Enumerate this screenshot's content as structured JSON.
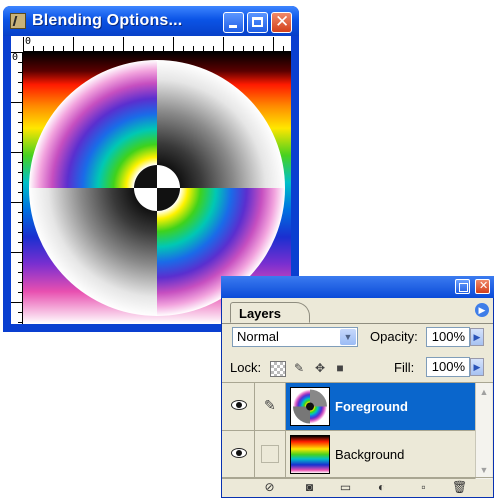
{
  "document_window": {
    "title": "Blending Options...",
    "ruler_h_label": "0",
    "ruler_v_label": "0"
  },
  "layers_panel": {
    "tab_label": "Layers",
    "blend_mode": "Normal",
    "opacity_label": "Opacity:",
    "opacity_value": "100%",
    "lock_label": "Lock:",
    "fill_label": "Fill:",
    "fill_value": "100%",
    "layers": [
      {
        "name": "Foreground",
        "visible": true,
        "selected": true
      },
      {
        "name": "Background",
        "visible": true,
        "selected": false
      }
    ]
  },
  "colors": {
    "titlebar_blue": "#0b54e6",
    "selection_blue": "#0a66cc",
    "panel_bg": "#ece9d8",
    "close_red": "#d3401c"
  }
}
